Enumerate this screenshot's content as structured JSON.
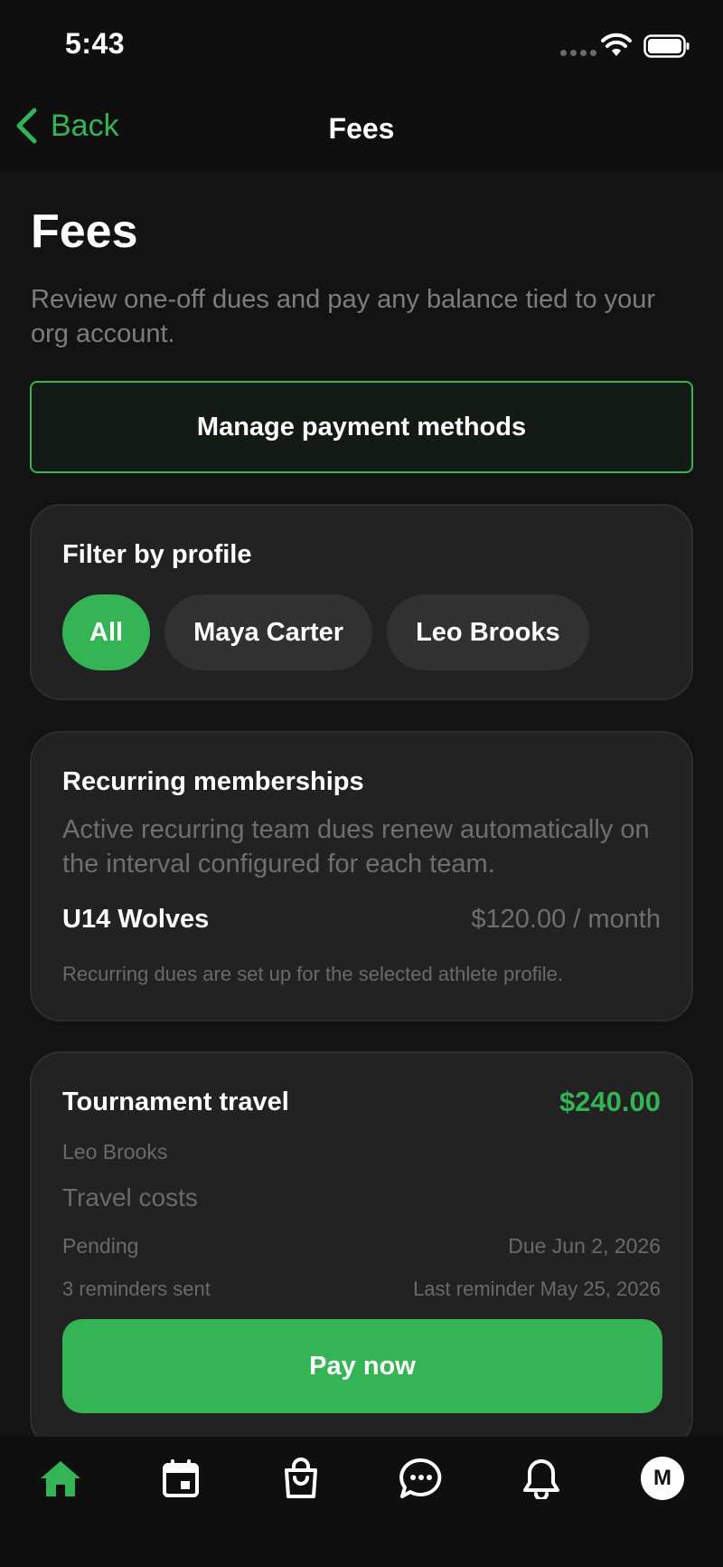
{
  "status_bar": {
    "time": "5:43"
  },
  "nav": {
    "back_label": "Back",
    "title": "Fees"
  },
  "page": {
    "title": "Fees",
    "subtitle": "Review one-off dues and pay any balance tied to your org account.",
    "manage_button": "Manage payment methods"
  },
  "filter": {
    "label": "Filter by profile",
    "chips": [
      {
        "label": "All",
        "active": true
      },
      {
        "label": "Maya Carter",
        "active": false
      },
      {
        "label": "Leo Brooks",
        "active": false
      }
    ]
  },
  "recurring": {
    "title": "Recurring memberships",
    "description": "Active recurring team dues renew automatically on the interval configured for each team.",
    "team": "U14 Wolves",
    "price": "$120.00 / month",
    "note": "Recurring dues are set up for the selected athlete profile."
  },
  "fee": {
    "title": "Tournament travel",
    "amount": "$240.00",
    "profile": "Leo Brooks",
    "description": "Travel costs",
    "status": "Pending",
    "due": "Due Jun 2, 2026",
    "reminders": "3 reminders sent",
    "last_reminder": "Last reminder May 25, 2026",
    "pay_button": "Pay now"
  },
  "tab_bar": {
    "items": [
      {
        "icon": "home-icon",
        "active": true
      },
      {
        "icon": "calendar-icon",
        "active": false
      },
      {
        "icon": "shopping-bag-icon",
        "active": false
      },
      {
        "icon": "chat-icon",
        "active": false
      },
      {
        "icon": "bell-icon",
        "active": false
      },
      {
        "icon": "avatar",
        "active": false
      }
    ],
    "avatar_initial": "M"
  },
  "colors": {
    "accent": "#34b454",
    "background": "#131313",
    "card": "#222222",
    "muted_text": "#6f6f6f"
  }
}
